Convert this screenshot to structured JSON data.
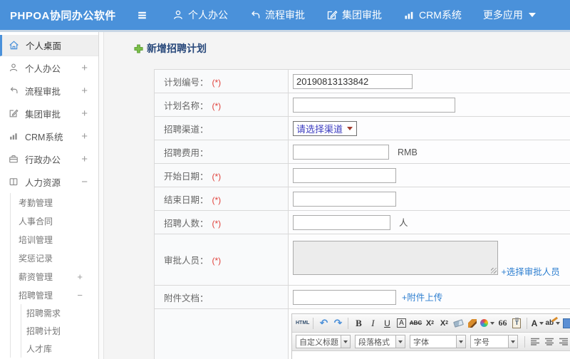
{
  "app": {
    "title": "PHPOA协同办公软件"
  },
  "topnav": {
    "items": [
      {
        "label": "个人办公",
        "icon": "user-icon"
      },
      {
        "label": "流程审批",
        "icon": "workflow-icon"
      },
      {
        "label": "集团审批",
        "icon": "edit-icon"
      },
      {
        "label": "CRM系统",
        "icon": "chart-icon"
      },
      {
        "label": "更多应用",
        "icon": "caret-down-icon"
      }
    ]
  },
  "sidebar": {
    "desktop": {
      "label": "个人桌面"
    },
    "groups": [
      {
        "label": "个人办公",
        "toggle": "+"
      },
      {
        "label": "流程审批",
        "toggle": "+"
      },
      {
        "label": "集团审批",
        "toggle": "+"
      },
      {
        "label": "CRM系统",
        "toggle": "+"
      },
      {
        "label": "行政办公",
        "toggle": "+"
      },
      {
        "label": "人力资源",
        "toggle": "−"
      }
    ],
    "hr_children": [
      {
        "label": "考勤管理"
      },
      {
        "label": "人事合同"
      },
      {
        "label": "培训管理"
      },
      {
        "label": "奖惩记录"
      },
      {
        "label": "薪资管理",
        "toggle": "+"
      },
      {
        "label": "招聘管理",
        "toggle": "−"
      }
    ],
    "recruit_children": [
      {
        "label": "招聘需求"
      },
      {
        "label": "招聘计划"
      },
      {
        "label": "人才库"
      }
    ]
  },
  "main": {
    "title": "新增招聘计划",
    "form": {
      "plan_no": {
        "label": "计划编号：",
        "required": "(*)",
        "value": "20190813133842"
      },
      "plan_name": {
        "label": "计划名称：",
        "required": "(*)",
        "value": ""
      },
      "channel": {
        "label": "招聘渠道：",
        "select_value": "请选择渠道"
      },
      "fee": {
        "label": "招聘费用：",
        "value": "",
        "suffix": "RMB"
      },
      "start_date": {
        "label": "开始日期：",
        "required": "(*)",
        "value": ""
      },
      "end_date": {
        "label": "结束日期：",
        "required": "(*)",
        "value": ""
      },
      "headcount": {
        "label": "招聘人数：",
        "required": "(*)",
        "value": "",
        "suffix": "人"
      },
      "approvers": {
        "label": "审批人员：",
        "required": "(*)",
        "value": "",
        "link": "+选择审批人员"
      },
      "attachment": {
        "label": "附件文档：",
        "value": "",
        "link": "+附件上传"
      }
    }
  },
  "editor": {
    "toolbar1": {
      "html_label": "HTML",
      "undo": "↶",
      "redo": "↷",
      "bold": "B",
      "italic": "I",
      "underline": "U",
      "char_border": "A",
      "strike": "ABC",
      "sup_x": "X",
      "sup_n": "2",
      "sub_x": "X",
      "sub_n": "2",
      "quote": "66",
      "paste_t": "T",
      "font_color": "A",
      "highlight": "ab"
    },
    "toolbar2": {
      "custom_title": "自定义标题",
      "paragraph": "段落格式",
      "font_family": "字体",
      "font_size": "字号"
    }
  }
}
